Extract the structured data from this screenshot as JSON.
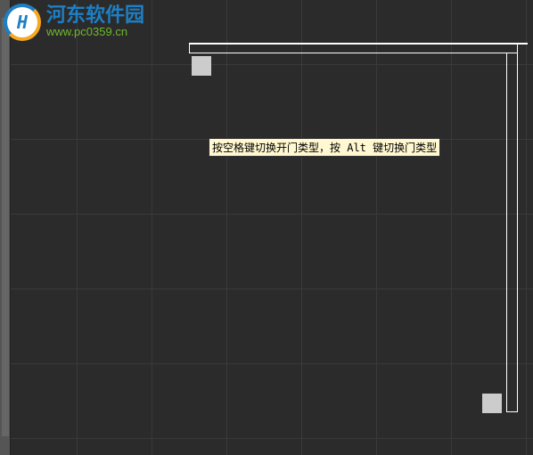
{
  "tooltip": {
    "text": "按空格键切换开门类型，按 Alt 键切换门类型"
  },
  "watermark": {
    "title": "河东软件园",
    "url": "www.pc0359.cn"
  },
  "colors": {
    "canvas_bg": "#2b2b2b",
    "grid_line": "#3a3a3a",
    "wall_line": "#ffffff",
    "handle_fill": "#cccccc",
    "tooltip_bg": "#fff8d0",
    "tooltip_text": "#000000"
  }
}
